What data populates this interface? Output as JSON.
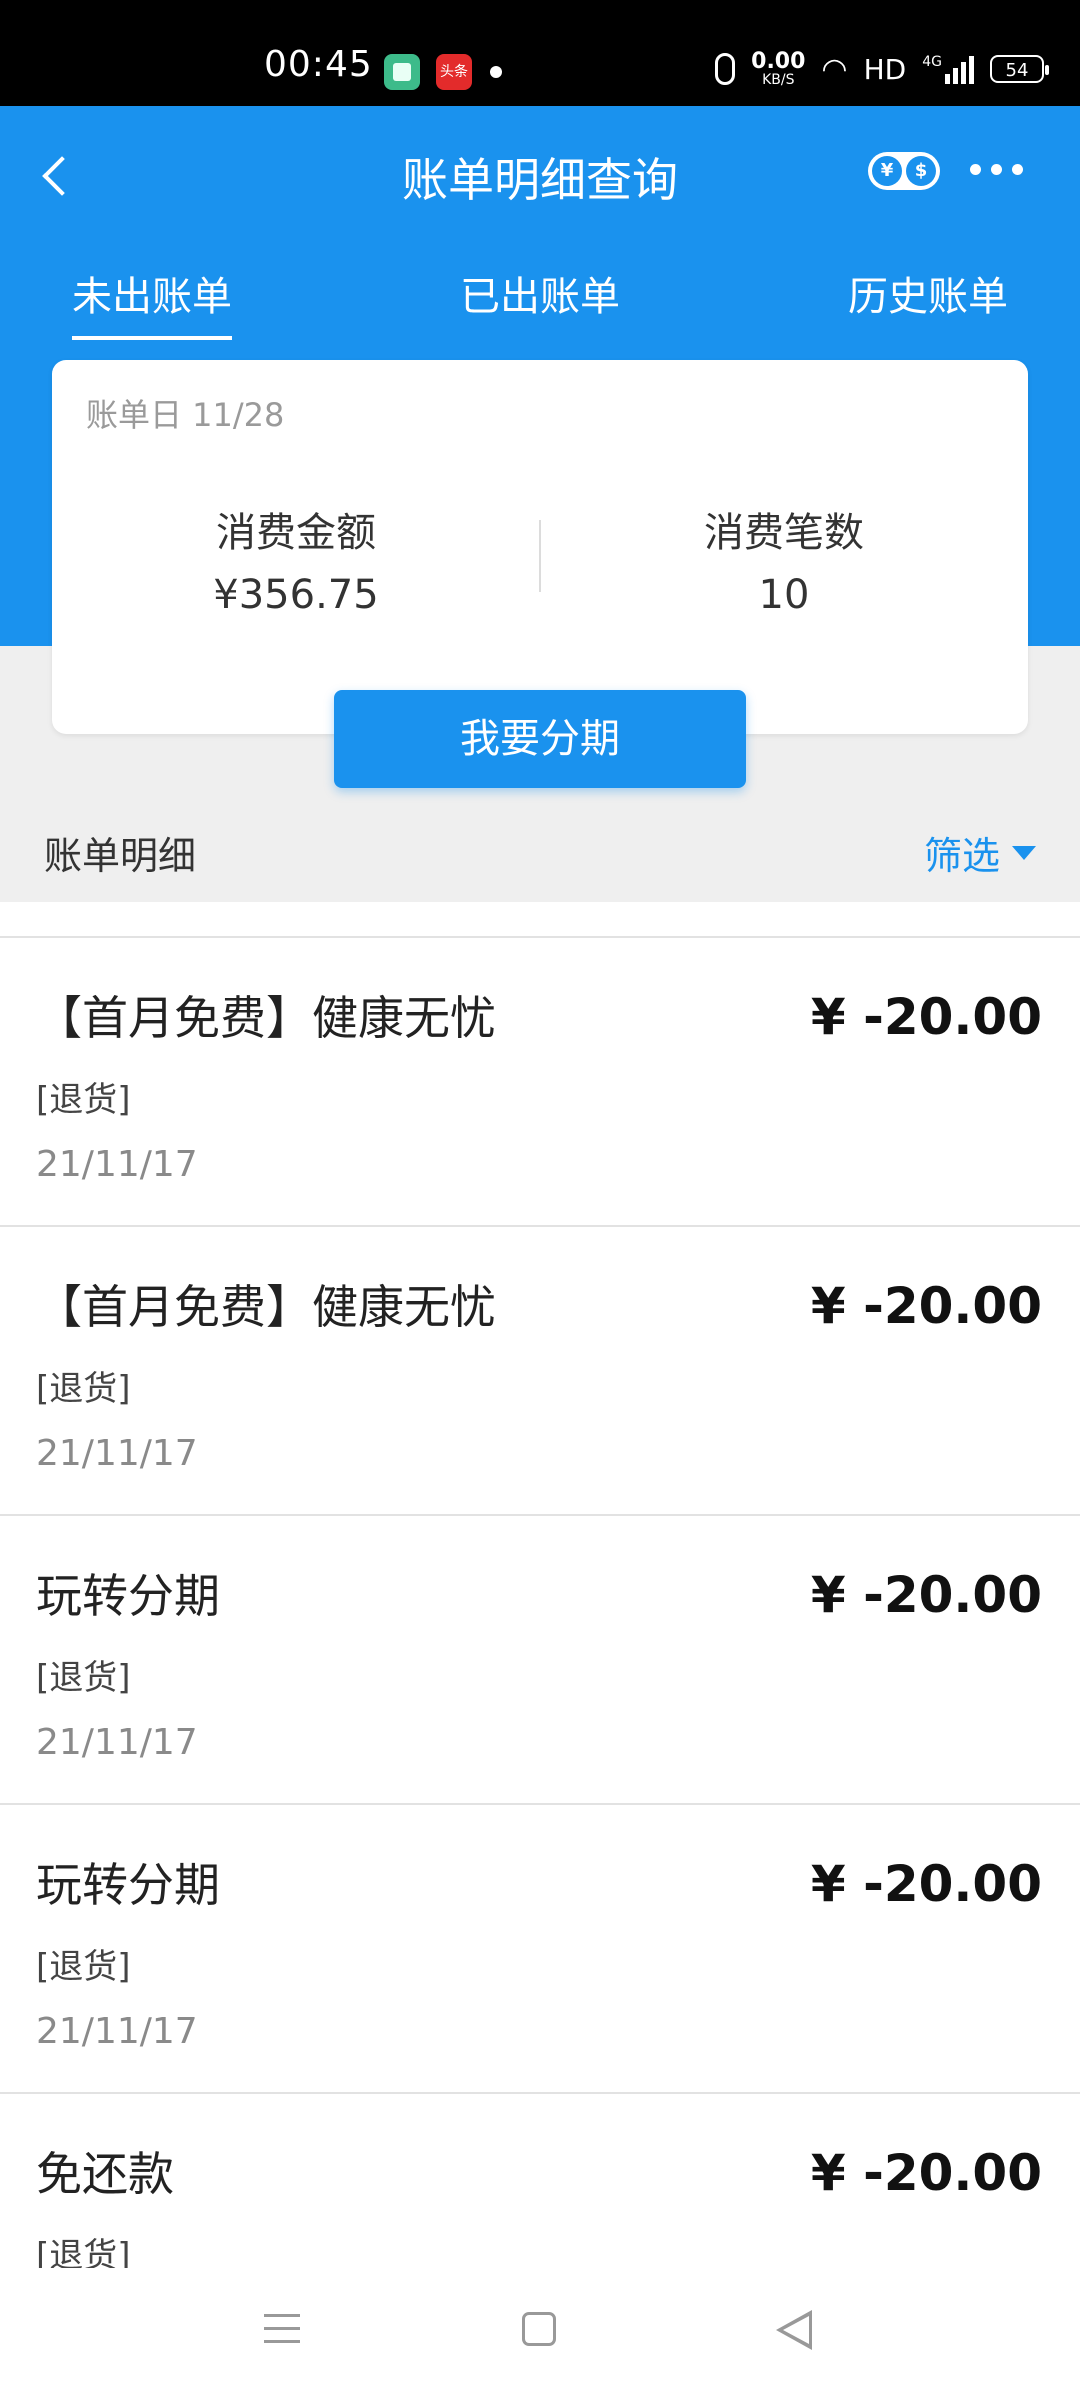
{
  "status_bar": {
    "time": "00:45",
    "app_badge": "头条",
    "speed_value": "0.00",
    "speed_unit": "KB/S",
    "network": "HD",
    "signal_label": "4G",
    "battery": "54"
  },
  "header": {
    "title": "账单明细查询",
    "currency_toggle": [
      "¥",
      "$"
    ]
  },
  "tabs": [
    {
      "label": "未出账单",
      "active": true
    },
    {
      "label": "已出账单",
      "active": false
    },
    {
      "label": "历史账单",
      "active": false
    }
  ],
  "summary": {
    "bill_date": "账单日 11/28",
    "amount_label": "消费金额",
    "amount_value": "¥356.75",
    "count_label": "消费笔数",
    "count_value": "10"
  },
  "installment_button": "我要分期",
  "details": {
    "title": "账单明细",
    "filter_label": "筛选"
  },
  "transactions": [
    {
      "name": "【首月免费】健康无忧",
      "tag": "[退货]",
      "date": "21/11/17",
      "amount": "¥ -20.00"
    },
    {
      "name": "【首月免费】健康无忧",
      "tag": "[退货]",
      "date": "21/11/17",
      "amount": "¥ -20.00"
    },
    {
      "name": "玩转分期",
      "tag": "[退货]",
      "date": "21/11/17",
      "amount": "¥ -20.00"
    },
    {
      "name": "玩转分期",
      "tag": "[退货]",
      "date": "21/11/17",
      "amount": "¥ -20.00"
    },
    {
      "name": "免还款",
      "tag": "[退货]",
      "date": "",
      "amount": "¥ -20.00"
    }
  ],
  "colors": {
    "accent": "#1a92ee",
    "background_grey": "#efefef"
  }
}
